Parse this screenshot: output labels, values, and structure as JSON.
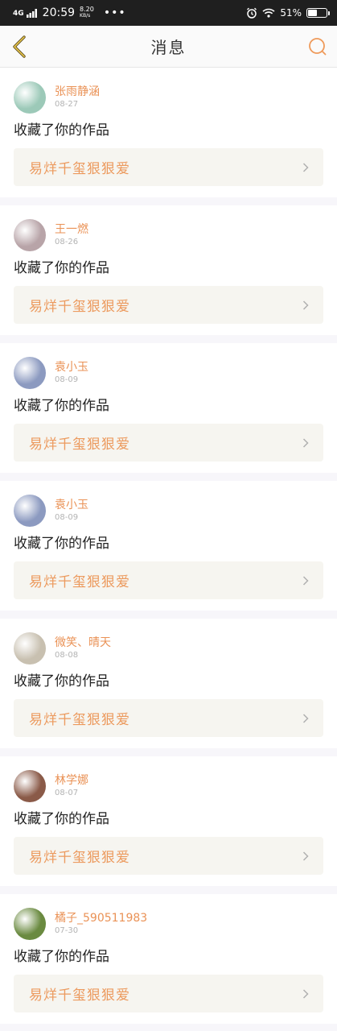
{
  "status_bar": {
    "network": "4G",
    "time": "20:59",
    "speed_value": "8.20",
    "speed_unit": "KB/s",
    "more": "•••",
    "battery": "51%",
    "battery_level": 0.51
  },
  "header": {
    "title": "消息"
  },
  "colors": {
    "accent": "#ea9256",
    "card_bg": "#f6f5f0",
    "divider": "#f7f6fa"
  },
  "items": [
    {
      "name": "张雨静涵",
      "date": "08-27",
      "action": "收藏了你的作品",
      "work": "易烊千玺狠狠爱",
      "avatar_color": "#9cc9b8"
    },
    {
      "name": "王一燃",
      "date": "08-26",
      "action": "收藏了你的作品",
      "work": "易烊千玺狠狠爱",
      "avatar_color": "#b8a4a8"
    },
    {
      "name": "袁小玉",
      "date": "08-09",
      "action": "收藏了你的作品",
      "work": "易烊千玺狠狠爱",
      "avatar_color": "#8c9ac0"
    },
    {
      "name": "袁小玉",
      "date": "08-09",
      "action": "收藏了你的作品",
      "work": "易烊千玺狠狠爱",
      "avatar_color": "#8c9ac0"
    },
    {
      "name": "微笑、晴天",
      "date": "08-08",
      "action": "收藏了你的作品",
      "work": "易烊千玺狠狠爱",
      "avatar_color": "#c8c0b0"
    },
    {
      "name": "林学娜",
      "date": "08-07",
      "action": "收藏了你的作品",
      "work": "易烊千玺狠狠爱",
      "avatar_color": "#8a5a48"
    },
    {
      "name": "橘子_590511983",
      "date": "07-30",
      "action": "收藏了你的作品",
      "work": "易烊千玺狠狠爱",
      "avatar_color": "#6a8a40"
    }
  ]
}
